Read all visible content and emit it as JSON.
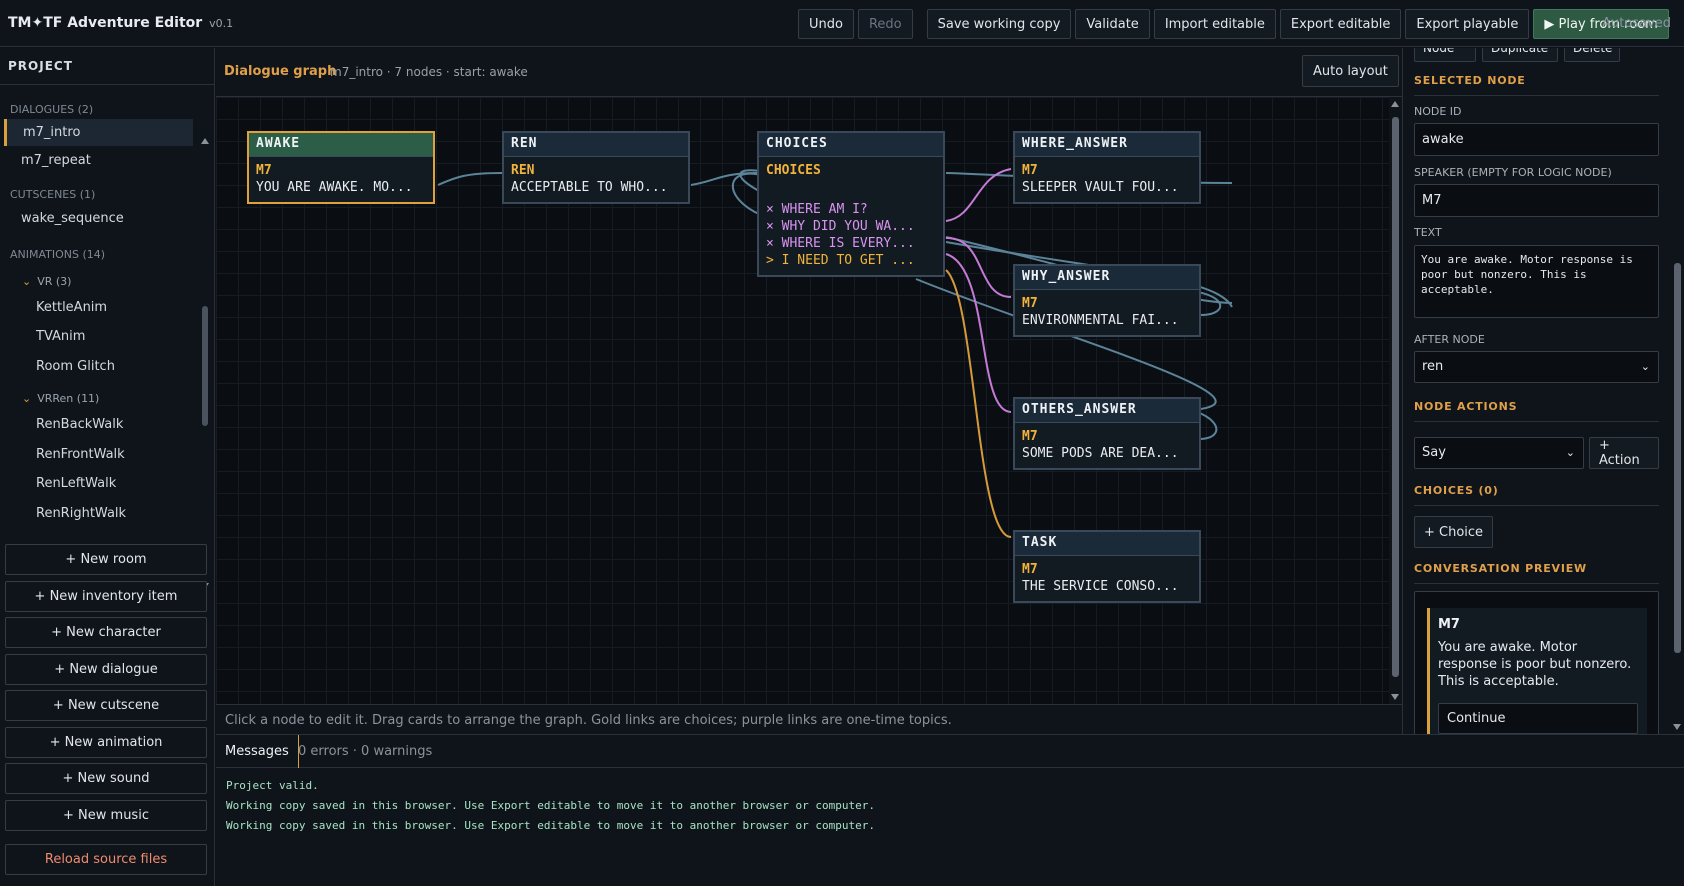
{
  "app": {
    "title": "TM✦TF Adventure Editor",
    "version": "v0.1",
    "autosave_status": "Autosaved"
  },
  "toolbar": {
    "undo": "Undo",
    "redo": "Redo",
    "save_working_copy": "Save working copy",
    "validate": "Validate",
    "import_editable": "Import editable",
    "export_editable": "Export editable",
    "export_playable": "Export playable",
    "play_from_room": "▶ Play from room"
  },
  "sidebar": {
    "header": "PROJECT",
    "sections": {
      "dialogues": "DIALOGUES (2)",
      "cutscenes": "CUTSCENES (1)",
      "animations": "ANIMATIONS (14)"
    },
    "dialogues": [
      "m7_intro",
      "m7_repeat"
    ],
    "cutscenes": [
      "wake_sequence"
    ],
    "groups": {
      "vr": "VR (3)",
      "vrren": "VRRen (11)"
    },
    "vr_items": [
      "KettleAnim",
      "TVAnim",
      "Room Glitch"
    ],
    "vrren_items": [
      "RenBackWalk",
      "RenFrontWalk",
      "RenLeftWalk",
      "RenRightWalk"
    ],
    "buttons": {
      "new_room": "+ New room",
      "new_inventory_item": "+ New inventory item",
      "new_character": "+ New character",
      "new_dialogue": "+ New dialogue",
      "new_cutscene": "+ New cutscene",
      "new_animation": "+ New animation",
      "new_sound": "+ New sound",
      "new_music": "+ New music",
      "reload_source_files": "Reload source files"
    }
  },
  "graph": {
    "title": "Dialogue graph",
    "meta": "m7_intro · 7 nodes · start: awake",
    "auto_layout": "Auto layout",
    "hint": "Click a node to edit it. Drag cards to arrange the graph. Gold links are choices; purple links are one-time topics.",
    "link_colors": {
      "flow": "#5c8499",
      "choice": "#d59a3a",
      "topic": "#c57ad6"
    },
    "nodes": {
      "awake": {
        "id": "AWAKE",
        "speaker": "M7",
        "text": "YOU ARE AWAKE. MO..."
      },
      "ren": {
        "id": "REN",
        "speaker": "REN",
        "text": "ACCEPTABLE TO WHO..."
      },
      "choices": {
        "id": "CHOICES",
        "speaker": "CHOICES",
        "options": [
          "× WHERE AM I?",
          "× WHY DID YOU WA...",
          "× WHERE IS EVERY...",
          "> I NEED TO GET ..."
        ]
      },
      "where_answer": {
        "id": "WHERE_ANSWER",
        "speaker": "M7",
        "text": "SLEEPER VAULT FOU..."
      },
      "why_answer": {
        "id": "WHY_ANSWER",
        "speaker": "M7",
        "text": "ENVIRONMENTAL FAI..."
      },
      "others_answer": {
        "id": "OTHERS_ANSWER",
        "speaker": "M7",
        "text": "SOME PODS ARE DEA..."
      },
      "task": {
        "id": "TASK",
        "speaker": "M7",
        "text": "THE SERVICE CONSO..."
      }
    }
  },
  "inspector": {
    "cut_buttons": [
      "Node",
      "Duplicate",
      "Delete"
    ],
    "selected_node_header": "SELECTED NODE",
    "node_id_label": "NODE ID",
    "node_id_value": "awake",
    "speaker_label": "SPEAKER (EMPTY FOR LOGIC NODE)",
    "speaker_value": "M7",
    "text_label": "TEXT",
    "text_value": "You are awake. Motor response is poor but nonzero. This is acceptable.",
    "after_node_label": "AFTER NODE",
    "after_node_value": "ren",
    "node_actions_header": "NODE ACTIONS",
    "action_select_value": "Say",
    "add_action": "+ Action",
    "choices_header": "CHOICES (0)",
    "add_choice": "+ Choice",
    "preview_header": "CONVERSATION PREVIEW",
    "preview": {
      "speaker": "M7",
      "text": "You are awake. Motor response is poor but nonzero. This is acceptable.",
      "continue": "Continue"
    }
  },
  "messages": {
    "tab": "Messages",
    "summary": "0 errors · 0 warnings",
    "log": [
      "Project valid.",
      "Working copy saved in this browser. Use Export editable to move it to another browser or computer.",
      "Working copy saved in this browser. Use Export editable to move it to another browser or computer."
    ]
  }
}
